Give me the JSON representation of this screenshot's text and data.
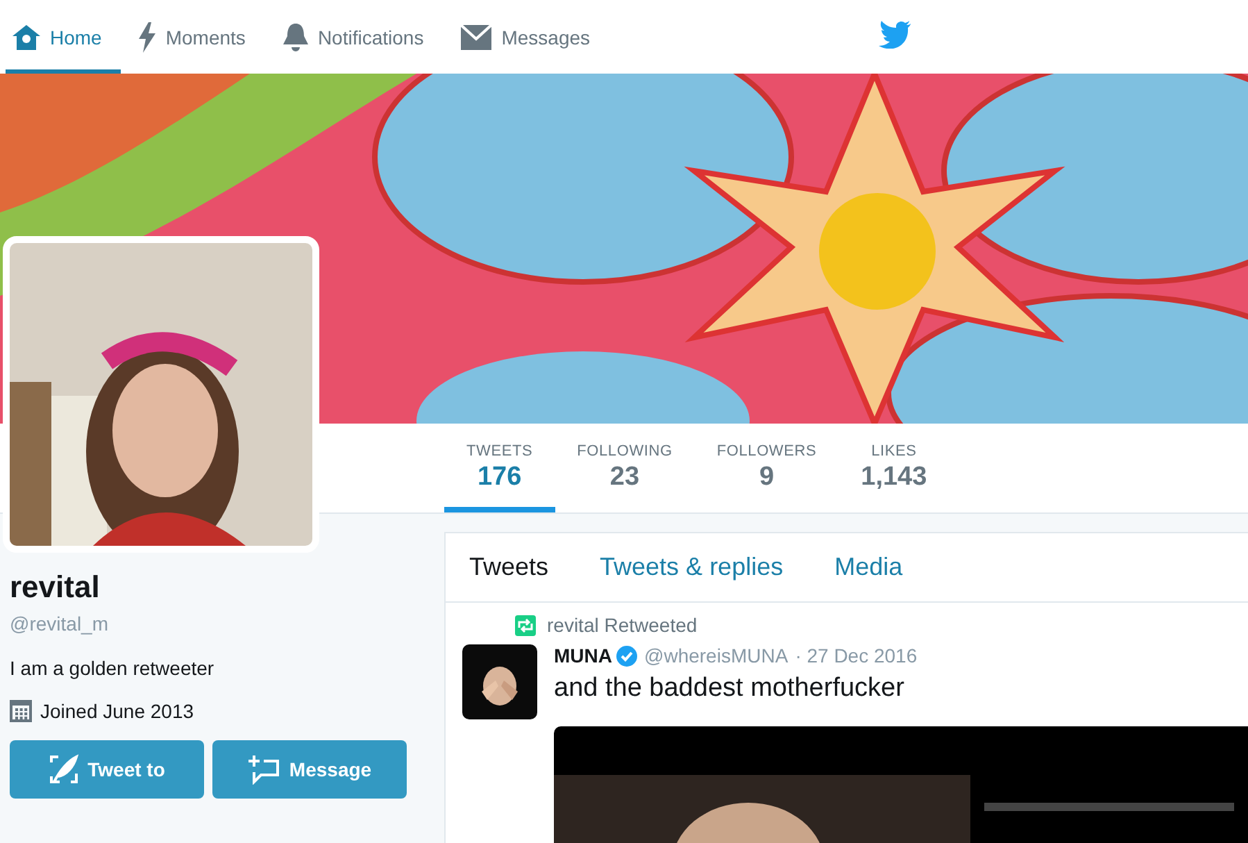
{
  "nav": [
    {
      "label": "Home",
      "selected": true
    },
    {
      "label": "Moments",
      "selected": false
    },
    {
      "label": "Notifications",
      "selected": false
    },
    {
      "label": "Messages",
      "selected": false
    }
  ],
  "stats": [
    {
      "label": "TWEETS",
      "value": "176",
      "selected": true
    },
    {
      "label": "FOLLOWING",
      "value": "23",
      "selected": false
    },
    {
      "label": "FOLLOWERS",
      "value": "9",
      "selected": false
    },
    {
      "label": "LIKES",
      "value": "1,143",
      "selected": false
    }
  ],
  "profile": {
    "name": "revital",
    "handle": "@revital_m",
    "bio": "I am a golden retweeter",
    "joined": "Joined June 2013"
  },
  "actions": [
    {
      "label": "Tweet to"
    },
    {
      "label": "Message"
    }
  ],
  "tabs": [
    {
      "label": "Tweets",
      "selected": true
    },
    {
      "label": "Tweets & replies",
      "selected": false
    },
    {
      "label": "Media",
      "selected": false
    }
  ],
  "tweet": {
    "context": "revital Retweeted",
    "author": "MUNA",
    "verified": true,
    "handle": "@whereisMUNA",
    "date": "· 27 Dec 2016",
    "text": "and the baddest motherfucker"
  }
}
